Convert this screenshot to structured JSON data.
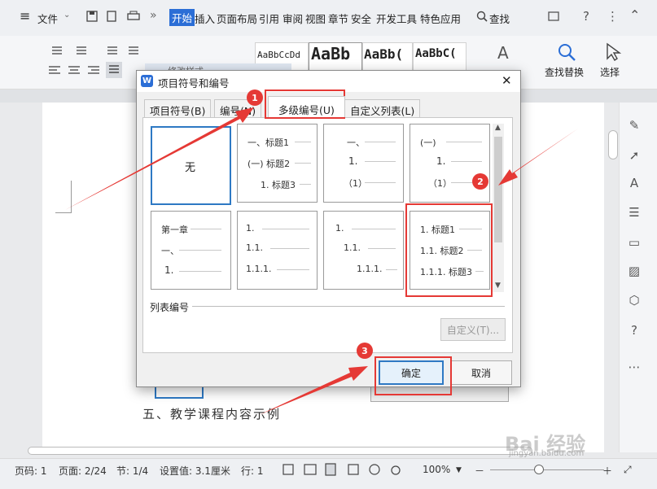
{
  "menubar": {
    "hamburger": "≡",
    "file_label": "文件",
    "tabs": [
      "开始",
      "插入",
      "页面布局",
      "引用",
      "审阅",
      "视图",
      "章节",
      "安全",
      "开发工具",
      "特色应用"
    ],
    "search_label": "查找",
    "right_icons": [
      "?",
      "⋮"
    ]
  },
  "ribbon": {
    "styles": [
      "AaBbCcDd",
      "AaBb",
      "AaBb(",
      "AaBbC("
    ],
    "find_replace": "查找替换",
    "select": "选择",
    "bg_dialog_title": "修改样式"
  },
  "document": {
    "body_text": "五、教学课程内容示例"
  },
  "dialog": {
    "title": "项目符号和编号",
    "close": "✕",
    "tabs": [
      "项目符号(B)",
      "编号(N)",
      "多级编号(U)",
      "自定义列表(L)"
    ],
    "grid": [
      {
        "lines": [
          "无"
        ]
      },
      {
        "lines": [
          "一、标题1",
          "(一) 标题2",
          "1. 标题3"
        ]
      },
      {
        "lines": [
          "一、",
          "1.",
          "（1）"
        ]
      },
      {
        "lines": [
          "(一)",
          "1.",
          "（1）"
        ]
      },
      {
        "lines": [
          "第一章",
          "一、",
          "1."
        ]
      },
      {
        "lines": [
          "1.",
          "1.1.",
          "1.1.1."
        ]
      },
      {
        "lines": [
          "1.",
          "1.1.",
          "1.1.1."
        ]
      },
      {
        "lines": [
          "1. 标题1",
          "1.1. 标题2",
          "1.1.1. 标题3"
        ]
      }
    ],
    "section_label": "列表编号",
    "customize_button": "自定义(T)...",
    "ok_button": "确定",
    "cancel_button": "取消"
  },
  "annotations": {
    "badges": [
      "1",
      "2",
      "3"
    ]
  },
  "status": {
    "page_num": "页码: 1",
    "page_count": "页面: 2/24",
    "section": "节: 1/4",
    "setting": "设置值: 3.1厘米",
    "line": "行: 1",
    "zoom": "100%",
    "zoom_minus": "－",
    "zoom_plus": "＋"
  },
  "watermark": {
    "text": "Bai 经验",
    "url": "jingyan.baidu.com"
  },
  "colors": {
    "accent": "#2b6ed6",
    "annotation": "#e53935",
    "selection": "#2e79c4"
  }
}
